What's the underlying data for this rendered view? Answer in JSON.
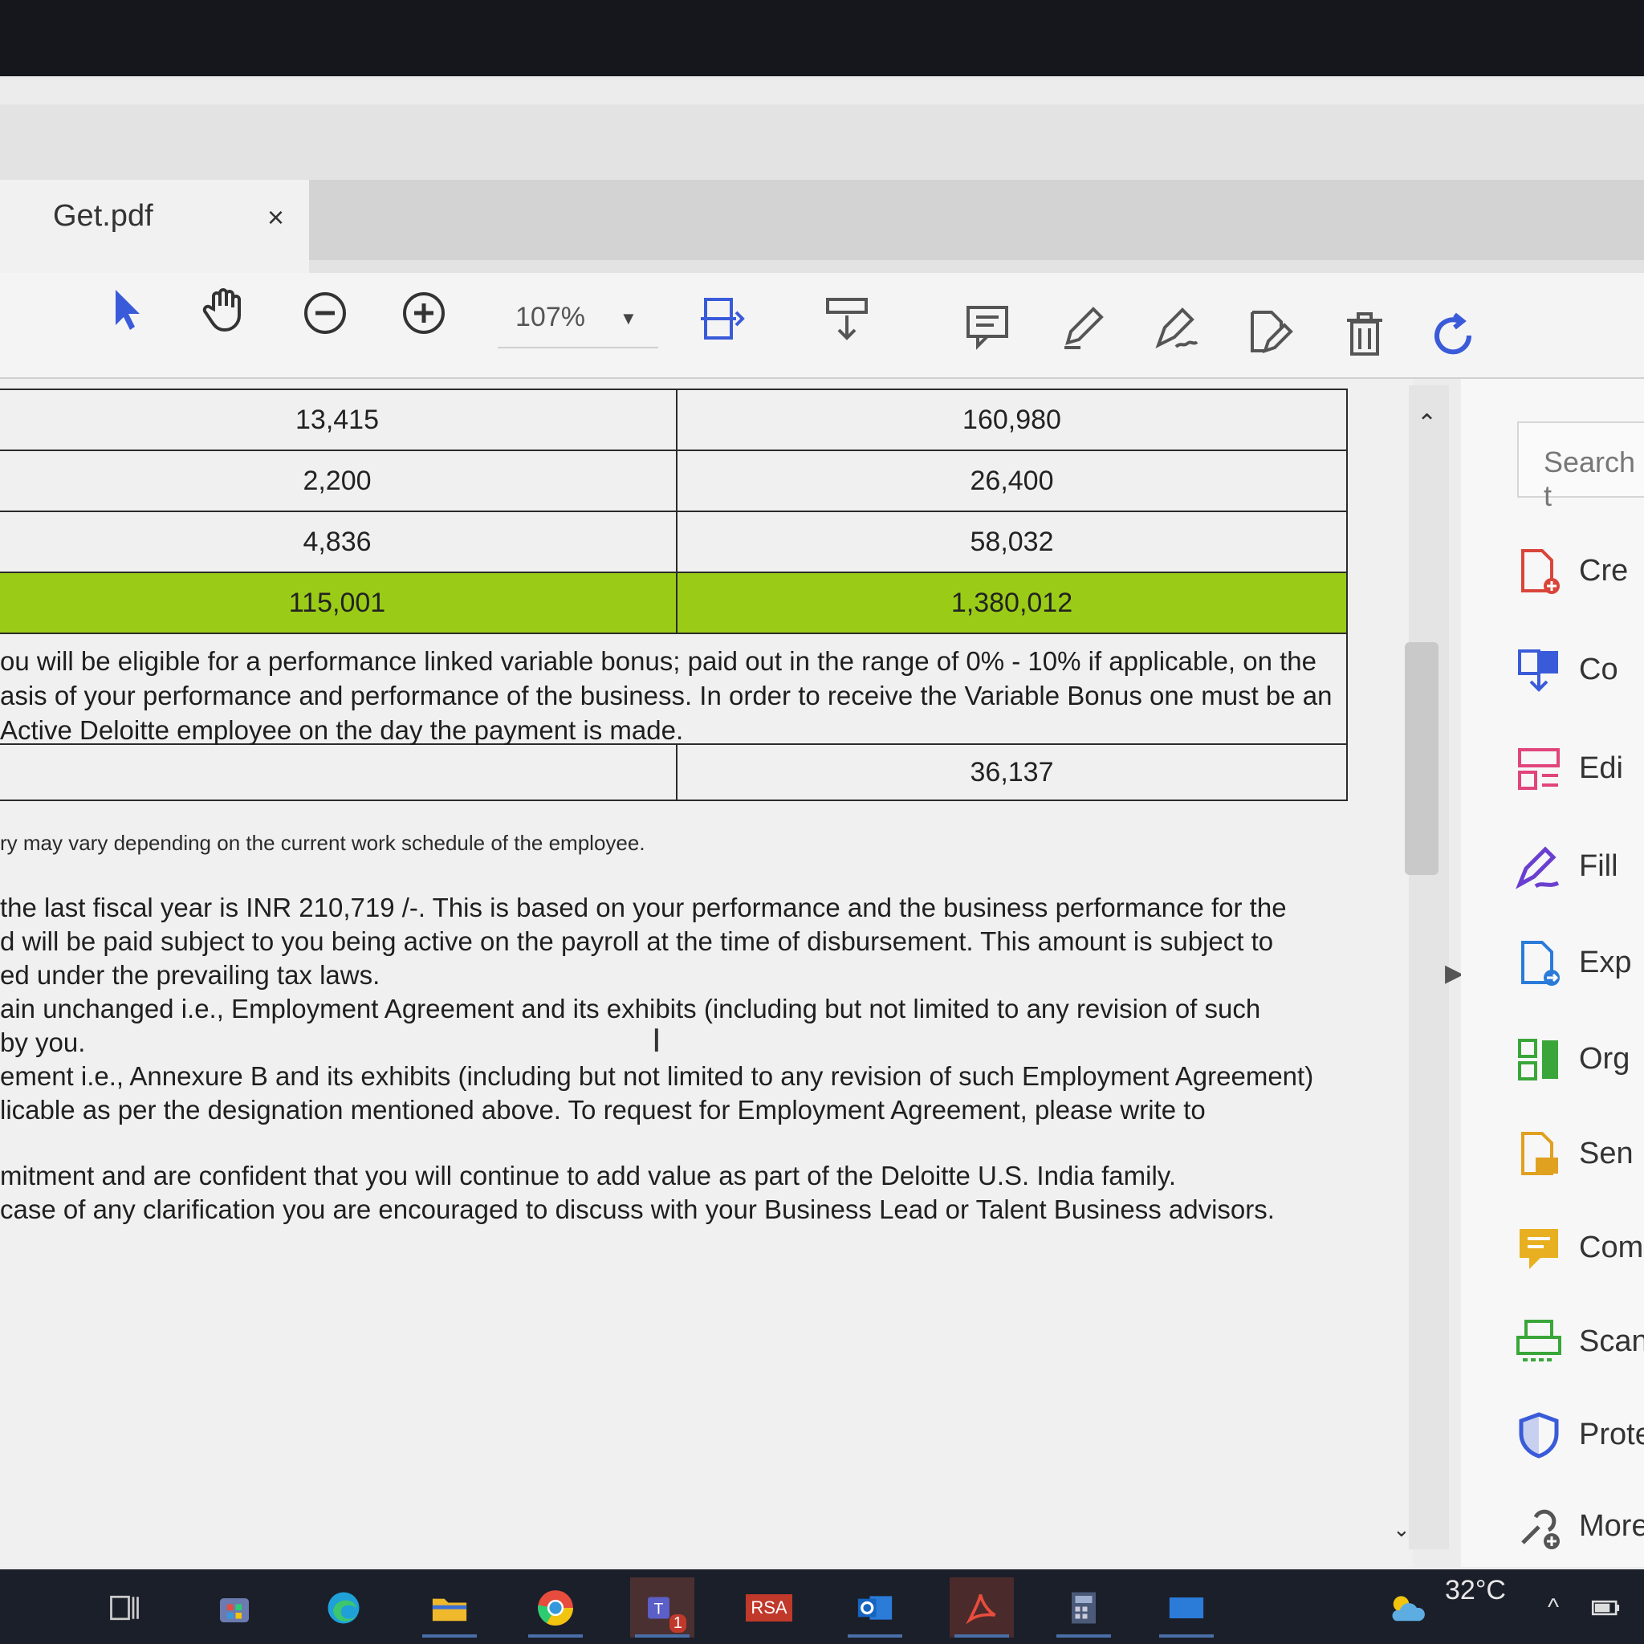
{
  "tab": {
    "title": "Get.pdf",
    "close": "×"
  },
  "toolbar": {
    "zoom": "107%"
  },
  "table": {
    "rows": [
      {
        "monthly": "13,415",
        "annual": "160,980"
      },
      {
        "monthly": "2,200",
        "annual": "26,400"
      },
      {
        "monthly": "4,836",
        "annual": "58,032"
      },
      {
        "monthly": "115,001",
        "annual": "1,380,012"
      }
    ],
    "bonus_text": "ou will be eligible for a performance linked variable bonus; paid out in the range of 0% - 10% if applicable, on the asis of your performance and performance of the business. In order to receive the Variable Bonus one must be an Active Deloitte employee on the day the payment is made.",
    "last_value": "36,137"
  },
  "footnote": "ry may vary depending on the current work schedule of the employee.",
  "paragraphs": [
    "the last fiscal year is INR 210,719 /-. This is based on your performance and the business performance for the",
    "d will be paid subject to you being active on the payroll at the time of disbursement. This amount is subject to",
    "ed under the prevailing tax laws.",
    "ain unchanged i.e., Employment Agreement and its exhibits (including but not limited to any revision of such",
    "by you.",
    "ement i.e., Annexure B and its exhibits (including but not limited to any revision of such Employment Agreement)",
    "licable as per the designation mentioned above. To request for Employment Agreement, please write to",
    "mitment and are confident that you will continue to add value as part of the Deloitte U.S. India family.",
    "case of any clarification you are encouraged to discuss with your Business Lead or Talent Business advisors."
  ],
  "tools_pane": {
    "search": "Search t",
    "items": [
      {
        "label": "Cre",
        "color": "#d9453b",
        "icon": "create-pdf-icon"
      },
      {
        "label": "Co",
        "color": "#3a5bd9",
        "icon": "combine-files-icon"
      },
      {
        "label": "Edi",
        "color": "#e0457b",
        "icon": "edit-pdf-icon"
      },
      {
        "label": "Fill",
        "color": "#6a3fd0",
        "icon": "fill-sign-icon"
      },
      {
        "label": "Exp",
        "color": "#2b7bd9",
        "icon": "export-pdf-icon"
      },
      {
        "label": "Org",
        "color": "#3aa63a",
        "icon": "organize-pages-icon"
      },
      {
        "label": "Sen",
        "color": "#e0a020",
        "icon": "send-for-comments-icon"
      },
      {
        "label": "Com",
        "color": "#e8b020",
        "icon": "comment-icon"
      },
      {
        "label": "Scan",
        "color": "#3aa63a",
        "icon": "scan-ocr-icon"
      },
      {
        "label": "Prote",
        "color": "#3a5bd9",
        "icon": "protect-icon"
      },
      {
        "label": "More",
        "color": "#555555",
        "icon": "more-tools-icon"
      }
    ]
  },
  "taskbar": {
    "temperature": "32°C",
    "teams_badge": "1",
    "rsa_label": "RSA"
  }
}
